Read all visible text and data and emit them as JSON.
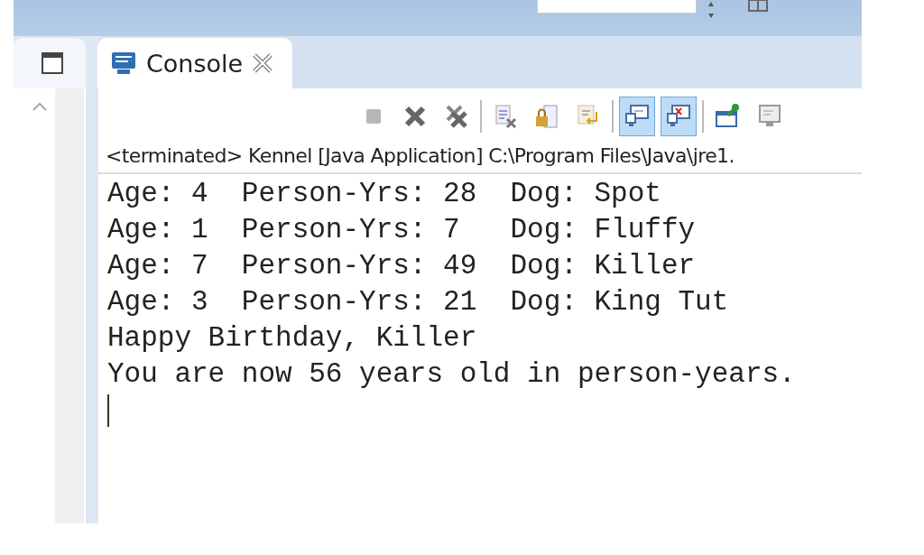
{
  "view": {
    "tab": {
      "label": "Console",
      "selected": true
    },
    "toolbar": [
      {
        "on": false,
        "disabled": true
      },
      {
        "on": false,
        "disabled": false
      },
      {
        "on": false,
        "disabled": false
      },
      {
        "on": false,
        "disabled": false
      },
      {
        "on": false,
        "disabled": false
      },
      {
        "on": false,
        "disabled": false
      },
      {
        "on": true,
        "disabled": false
      },
      {
        "on": true,
        "disabled": false
      },
      {
        "on": false,
        "disabled": false
      },
      {
        "on": false,
        "disabled": false
      }
    ],
    "status": "<terminated> Kennel [Java Application] C:\\Program Files\\Java\\jre1.",
    "output": [
      "Age: 4  Person-Yrs: 28  Dog: Spot",
      "Age: 1  Person-Yrs: 7   Dog: Fluffy",
      "Age: 7  Person-Yrs: 49  Dog: Killer",
      "Age: 3  Person-Yrs: 21  Dog: King Tut",
      "Happy Birthday, Killer",
      "You are now 56 years old in person-years."
    ]
  }
}
